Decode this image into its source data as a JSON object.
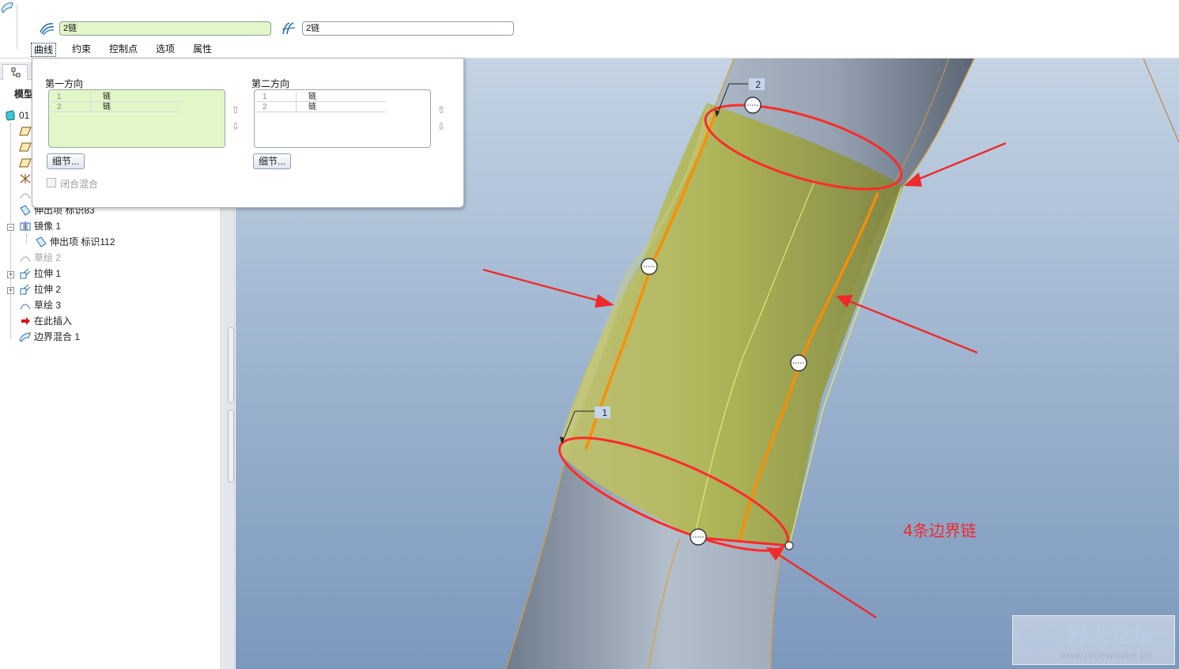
{
  "dashboard": {
    "first_collector": "2链",
    "second_collector": "2链",
    "tabs": [
      {
        "label": "曲线",
        "active": true
      },
      {
        "label": "约束",
        "active": false
      },
      {
        "label": "控制点",
        "active": false
      },
      {
        "label": "选项",
        "active": false
      },
      {
        "label": "属性",
        "active": false
      }
    ]
  },
  "slideup": {
    "first_direction": {
      "label": "第一方向",
      "rows": [
        {
          "num": "1",
          "value": "链"
        },
        {
          "num": "2",
          "value": "链"
        }
      ],
      "details_button": "细节..."
    },
    "second_direction": {
      "label": "第二方向",
      "rows": [
        {
          "num": "1",
          "value": "链"
        },
        {
          "num": "2",
          "value": "链"
        }
      ],
      "details_button": "细节..."
    },
    "closed_blend_label": "闭合混合",
    "closed_blend_checked": false
  },
  "model_tree": {
    "title": "模型",
    "items": [
      {
        "label": "01",
        "icon": "part-icon",
        "dim": false
      },
      {
        "label": "",
        "icon": "datum-plane-icon",
        "dim": false
      },
      {
        "label": "",
        "icon": "datum-plane-icon",
        "dim": false
      },
      {
        "label": "",
        "icon": "datum-plane-icon",
        "dim": false
      },
      {
        "label": "",
        "icon": "csys-icon",
        "dim": false
      },
      {
        "label": "",
        "icon": "sketch-icon",
        "dim": true
      },
      {
        "label": "伸出项 标识83",
        "icon": "protrusion-icon",
        "dim": false
      },
      {
        "label": "镜像 1",
        "icon": "mirror-icon",
        "dim": false
      },
      {
        "label": "伸出项 标识112",
        "icon": "protrusion-icon",
        "dim": false
      },
      {
        "label": "草绘 2",
        "icon": "sketch-icon",
        "dim": true
      },
      {
        "label": "拉伸 1",
        "icon": "extrude-icon",
        "dim": false
      },
      {
        "label": "拉伸 2",
        "icon": "extrude-icon",
        "dim": false
      },
      {
        "label": "草绘 3",
        "icon": "sketch-icon",
        "dim": false
      },
      {
        "label": "在此插入",
        "icon": "insert-here-icon",
        "dim": false
      },
      {
        "label": "边界混合 1",
        "icon": "boundary-blend-icon",
        "dim": false
      }
    ]
  },
  "viewport": {
    "chain_label_1": "1",
    "chain_label_2": "2",
    "annotation": "4条边界链",
    "annotation_color": "#ef2a2a"
  },
  "watermark": {
    "title": "野火论坛",
    "url": "www.proewildfire.cn"
  }
}
